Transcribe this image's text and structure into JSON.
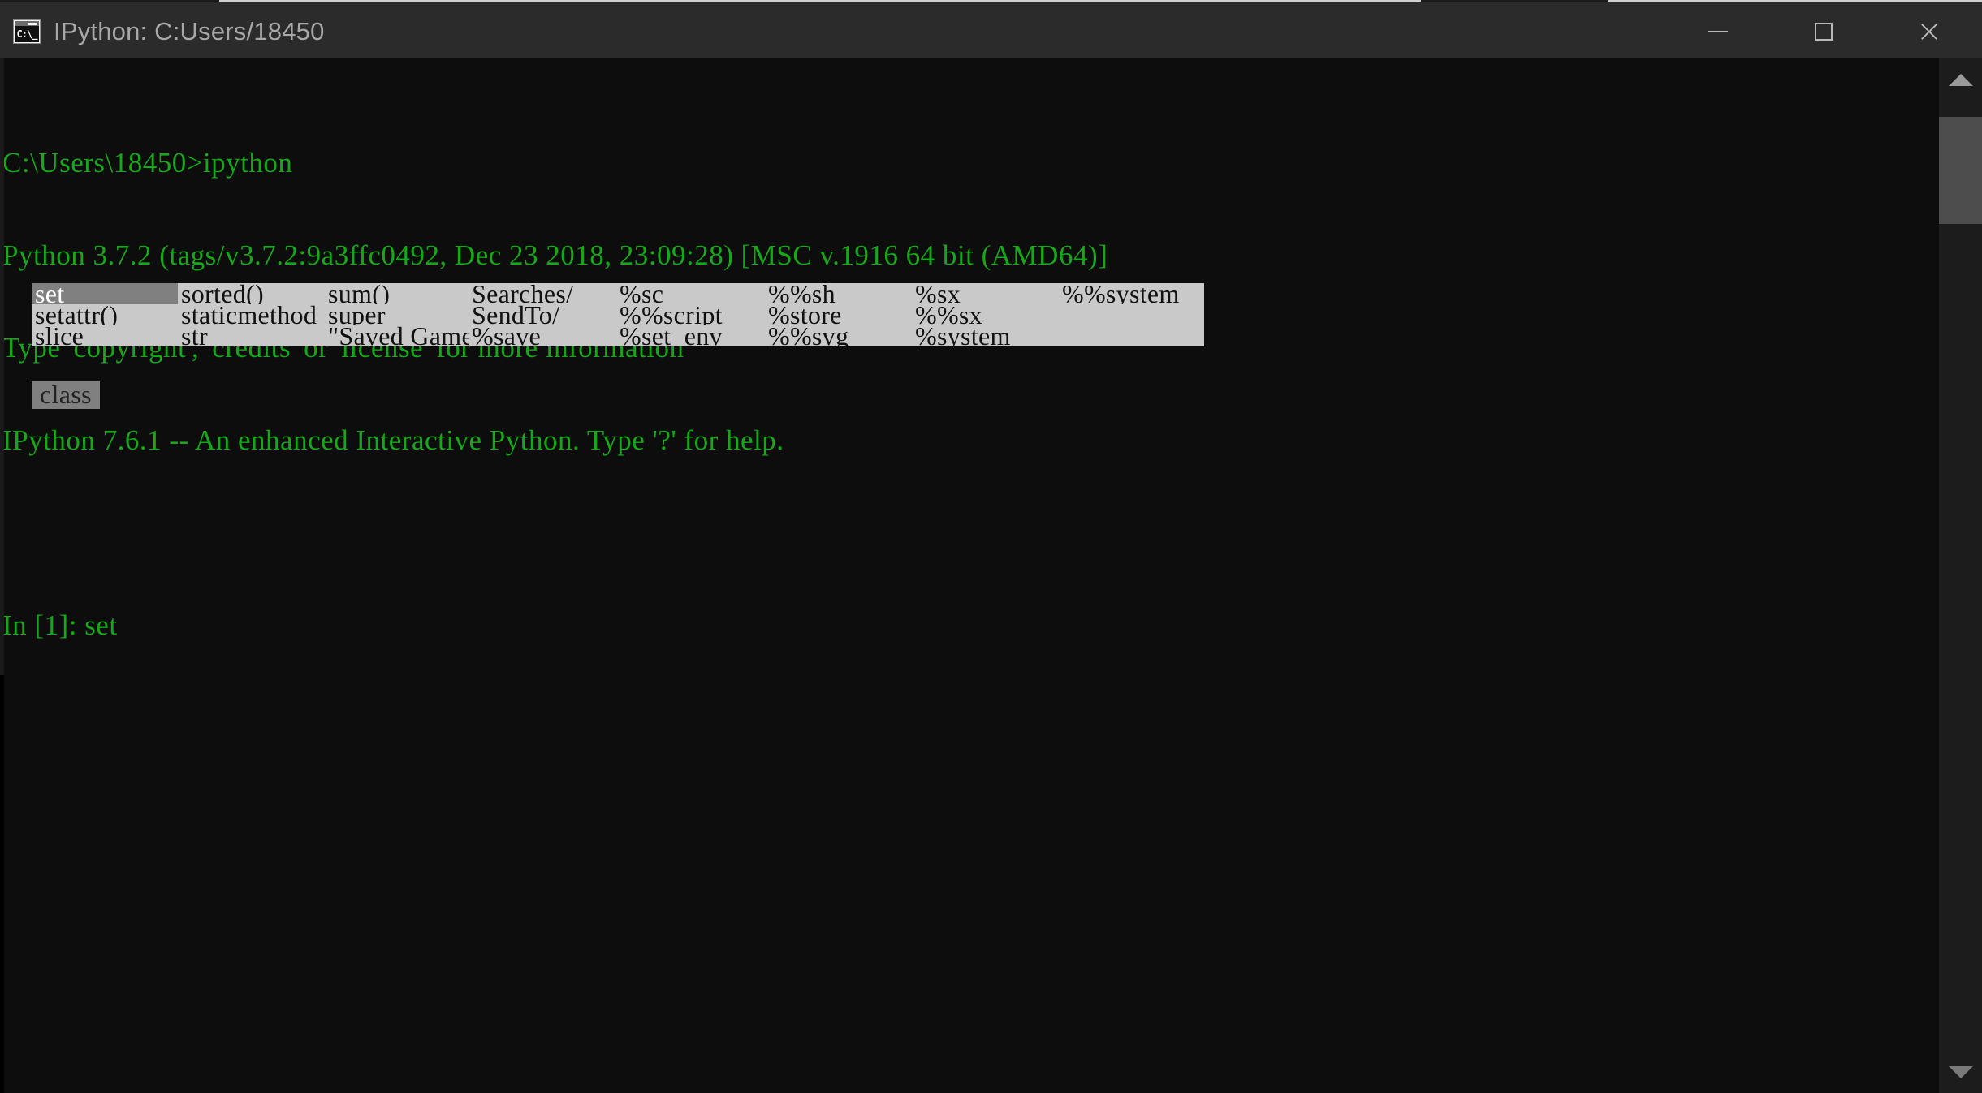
{
  "window": {
    "title": "IPython: C:Users/18450",
    "icon_name": "console-app-icon",
    "icon_glyph": "C:\\_",
    "controls": {
      "minimize_label": "Minimize",
      "maximize_label": "Maximize",
      "close_label": "Close"
    },
    "colors": {
      "titlebar_bg": "#2b2b2b",
      "title_fg": "#a8a8a8",
      "console_bg": "#0d0d0d",
      "terminal_fg": "#17a819",
      "popup_bg": "#c9c9c9",
      "popup_selected_bg": "#808080",
      "popup_fg": "#111111",
      "meta_bg": "#808080",
      "scrollbar_bg": "#1c1c1c",
      "scrollbar_thumb": "#4d4d4d"
    }
  },
  "terminal": {
    "lines": [
      "C:\\Users\\18450>ipython",
      "Python 3.7.2 (tags/v3.7.2:9a3ffc0492, Dec 23 2018, 23:09:28) [MSC v.1916 64 bit (AMD64)]",
      "Type 'copyright', 'credits' or 'license' for more information",
      "IPython 7.6.1 -- An enhanced Interactive Python. Type '?' for help.",
      "",
      "In [1]: set"
    ],
    "prompt": "In [1]: ",
    "current_input": "set"
  },
  "completion": {
    "selected_index": 0,
    "selected_value": "set",
    "meta_label": "class",
    "rows": [
      [
        "set",
        "sorted()",
        "sum()",
        "Searches/",
        "%sc",
        "%%sh",
        "%sx",
        "%%system"
      ],
      [
        "setattr()",
        "staticmethod",
        "super",
        "SendTo/",
        "%%script",
        "%store",
        "%%sx",
        ""
      ],
      [
        "slice",
        "str",
        "\"Saved Games\"",
        "%save",
        "%set_env",
        "%%svg",
        "%system",
        ""
      ]
    ]
  },
  "scrollbar": {
    "up_arrow": "scroll-up-arrow",
    "down_arrow": "scroll-down-arrow",
    "thumb": "scroll-thumb"
  }
}
